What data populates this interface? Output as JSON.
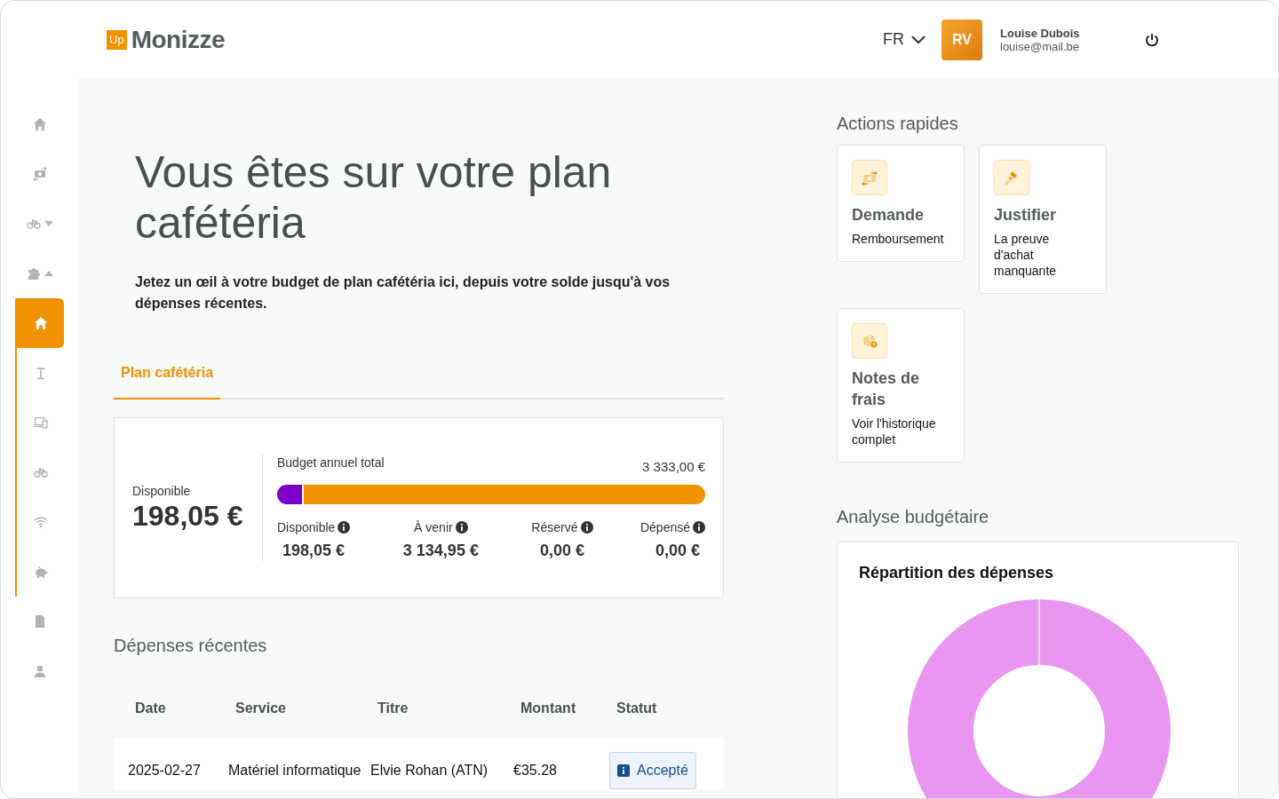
{
  "header": {
    "logo_badge": "Up",
    "logo_text": "Monizze",
    "language": "FR",
    "avatar_initials": "RV",
    "user_name": "Louise Dubois",
    "user_email": "louise@mail.be"
  },
  "sidebar": {
    "items": [
      {
        "selected": false
      },
      {
        "selected": false
      },
      {
        "selected": false,
        "expanded": false
      },
      {
        "selected": false,
        "expanded": true,
        "children": [
          {
            "selected": true
          },
          {
            "selected": false
          },
          {
            "selected": false
          },
          {
            "selected": false
          },
          {
            "selected": false
          },
          {
            "selected": false
          }
        ]
      },
      {
        "selected": false
      },
      {
        "selected": false
      }
    ]
  },
  "page": {
    "title": "Vous êtes sur votre plan cafétéria",
    "description": "Jetez un œil à votre budget de plan cafétéria ici, depuis votre solde jusqu'à vos dépenses récentes."
  },
  "tabs": [
    {
      "label": "Plan cafétéria",
      "selected": true
    }
  ],
  "budget": {
    "available_label": "Disponible",
    "available_value": "198,05 €",
    "total_label": "Budget annuel total",
    "total_value": "3 333,00 €",
    "segments": [
      {
        "level": 0.059,
        "color": "#7b00c8"
      },
      {
        "level": 0.941,
        "color": "#f39200"
      }
    ],
    "stats": [
      {
        "label": "Disponible",
        "value": "198,05 €"
      },
      {
        "label": "À venir",
        "value": "3 134,95 €"
      },
      {
        "label": "Réservé",
        "value": "0,00 €"
      },
      {
        "label": "Dépensé",
        "value": "0,00 €"
      }
    ]
  },
  "recent": {
    "title": "Dépenses récentes",
    "columns": [
      "Date",
      "Service",
      "Titre",
      "Montant",
      "Statut"
    ],
    "rows": [
      {
        "date": "2025-02-27",
        "service": "Matériel informatique",
        "title": "Elvie Rohan (ATN)",
        "amount": "€35.28",
        "status": "Accepté"
      }
    ]
  },
  "quick_actions": {
    "title": "Actions rapides",
    "items": [
      {
        "title": "Demande",
        "subtitle": "Remboursement"
      },
      {
        "title": "Justifier",
        "subtitle": "La preuve d'achat manquante"
      },
      {
        "title": "Notes de frais",
        "subtitle": "Voir l'historique complet"
      }
    ]
  },
  "analysis": {
    "title": "Analyse budgétaire",
    "card_title": "Répartition des dépenses"
  }
}
